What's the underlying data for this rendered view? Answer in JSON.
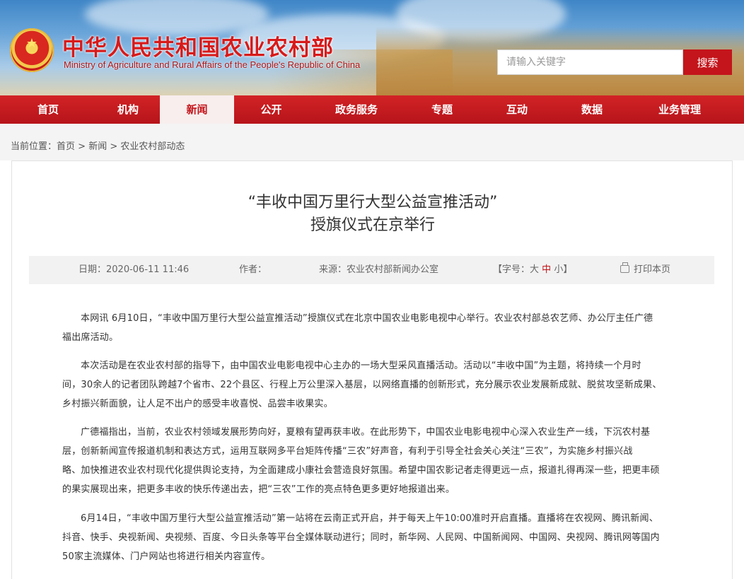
{
  "site": {
    "title": "中华人民共和国农业农村部",
    "subtitle": "Ministry of Agriculture and Rural Affairs of the People's Republic of China"
  },
  "search": {
    "placeholder": "请输入关键字",
    "button_label": "搜索"
  },
  "nav": {
    "items": [
      {
        "label": "首页"
      },
      {
        "label": "机构"
      },
      {
        "label": "新闻",
        "active": true
      },
      {
        "label": "公开"
      },
      {
        "label": "政务服务"
      },
      {
        "label": "专题"
      },
      {
        "label": "互动"
      },
      {
        "label": "数据"
      },
      {
        "label": "业务管理"
      }
    ]
  },
  "breadcrumb": {
    "prefix": "当前位置：",
    "items": [
      "首页",
      "新闻",
      "农业农村部动态"
    ],
    "separator": " > "
  },
  "article": {
    "title_line1": "“丰收中国万里行大型公益宣推活动”",
    "title_line2": "授旗仪式在京举行",
    "meta": {
      "date": "日期：2020-06-11 11:46",
      "author": "作者：",
      "source": "来源：农业农村部新闻办公室",
      "font_size_label": "【字号：",
      "font_size_options": [
        "大",
        "中",
        "小"
      ],
      "font_size_close": "】",
      "print_label": "打印本页"
    },
    "paragraphs": [
      [
        "本网讯  6月10日，“丰收中国万里行大型公益宣推活动”授旗仪式在北京中国农业电影电视中心举行。农业农村部总农艺师、办公厅主任广德",
        "福出席活动。"
      ],
      [
        "本次活动是在农业农村部的指导下，由中国农业电影电视中心主办的一场大型采风直播活动。活动以“丰收中国”为主题，将持续一个月时",
        "间，30余人的记者团队跨越7个省市、22个县区、行程上万公里深入基层，以网络直播的创新形式，充分展示农业发展新成就、脱贫攻坚新成果、",
        "乡村振兴新面貌，让人足不出户的感受丰收喜悦、品尝丰收果实。"
      ],
      [
        "广德福指出，当前，农业农村领域发展形势向好，夏粮有望再获丰收。在此形势下，中国农业电影电视中心深入农业生产一线，下沉农村基",
        "层，创新新闻宣传报道机制和表达方式，运用互联网多平台矩阵传播“三农”好声音，有利于引导全社会关心关注“三农”，为实施乡村振兴战",
        "略、加快推进农业农村现代化提供舆论支持，为全面建成小康社会营造良好氛围。希望中国农影记者走得更远一点，报道扎得再深一些，把更丰硕",
        "的果实展现出来，把更多丰收的快乐传递出去，把“三农”工作的亮点特色更多更好地报道出来。"
      ],
      [
        "6月14日，“丰收中国万里行大型公益宣推活动”第一站将在云南正式开启，并于每天上午10:00准时开启直播。直播将在农视网、腾讯新闻、",
        "抖音、快手、央视新闻、央视频、百度、今日头条等平台全媒体联动进行；同时，新华网、人民网、中国新闻网、中国网、央视网、腾讯网等国内",
        "50家主流媒体、门户网站也将进行相关内容宣传。"
      ]
    ]
  },
  "colors": {
    "brand_red": "#c3151b",
    "nav_active_bg": "#f8eeee",
    "meta_bg": "#f2f2f2"
  }
}
